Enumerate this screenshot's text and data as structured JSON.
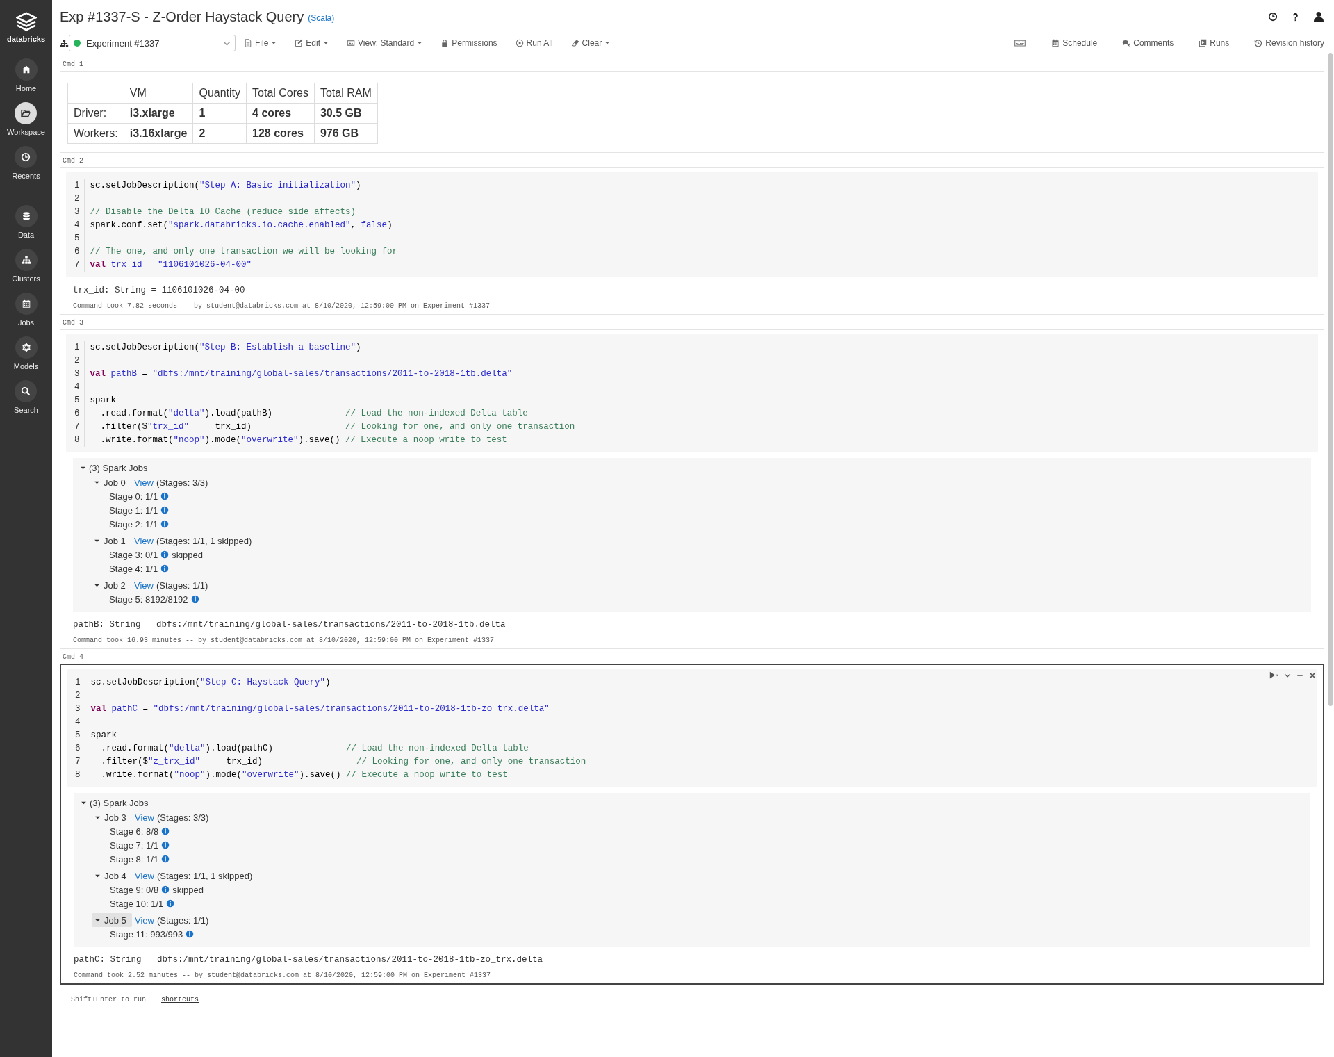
{
  "sidebar": {
    "logo": "databricks",
    "items": [
      {
        "label": "Home",
        "selected": false
      },
      {
        "label": "Workspace",
        "selected": true
      },
      {
        "label": "Recents",
        "selected": false
      },
      {
        "label": "Data",
        "selected": false
      },
      {
        "label": "Clusters",
        "selected": false
      },
      {
        "label": "Jobs",
        "selected": false
      },
      {
        "label": "Models",
        "selected": false
      },
      {
        "label": "Search",
        "selected": false
      }
    ]
  },
  "notebook": {
    "title": "Exp #1337-S - Z-Order Haystack Query",
    "language": "(Scala)",
    "cluster": "Experiment #1337",
    "toolbar_left": [
      {
        "label": "File",
        "menu": true
      },
      {
        "label": "Edit",
        "menu": true
      },
      {
        "label": "View: Standard",
        "menu": true
      },
      {
        "label": "Permissions",
        "menu": false
      },
      {
        "label": "Run All",
        "menu": false
      },
      {
        "label": "Clear",
        "menu": true
      }
    ],
    "toolbar_right": [
      {
        "kind": "icon"
      },
      {
        "kind": "button",
        "label": "Schedule"
      },
      {
        "kind": "button",
        "label": "Comments"
      },
      {
        "kind": "button",
        "label": "Runs"
      },
      {
        "kind": "button",
        "label": "Revision history"
      }
    ]
  },
  "cells": [
    {
      "label": "Cmd 1",
      "kind": "table",
      "active": false,
      "table": {
        "columns": [
          "VM",
          "Quantity",
          "Total Cores",
          "Total RAM"
        ],
        "rows": [
          {
            "label": "Driver:",
            "cells": [
              "i3.xlarge",
              "1",
              "4 cores",
              "30.5 GB"
            ]
          },
          {
            "label": "Workers:",
            "cells": [
              "i3.16xlarge",
              "2",
              "128 cores",
              "976 GB"
            ]
          }
        ]
      }
    },
    {
      "label": "Cmd 2",
      "kind": "code",
      "active": false,
      "code": [
        {
          "number": "1",
          "tokens": [
            {
              "kind": "plain",
              "text": "sc.setJobDescription("
            },
            {
              "kind": "string",
              "text": "\"Step A: Basic initialization\""
            },
            {
              "kind": "plain",
              "text": ")"
            }
          ]
        },
        {
          "number": "2"
        },
        {
          "number": "3",
          "tokens": [
            {
              "kind": "comment",
              "text": "// Disable the Delta IO Cache (reduce side affects)"
            }
          ]
        },
        {
          "number": "4",
          "tokens": [
            {
              "kind": "plain",
              "text": "spark.conf.set("
            },
            {
              "kind": "string",
              "text": "\"spark.databricks.io.cache.enabled\""
            },
            {
              "kind": "plain",
              "text": ", "
            },
            {
              "kind": "literal",
              "text": "false"
            },
            {
              "kind": "plain",
              "text": ")"
            }
          ]
        },
        {
          "number": "5"
        },
        {
          "number": "6",
          "tokens": [
            {
              "kind": "comment",
              "text": "// The one, and only one transaction we will be looking for"
            }
          ]
        },
        {
          "number": "7",
          "tokens": [
            {
              "kind": "keyword",
              "text": "val"
            },
            {
              "kind": "ident",
              "text": " trx_id"
            },
            {
              "kind": "plain",
              "text": " = "
            },
            {
              "kind": "string",
              "text": "\"1106101026-04-00\""
            }
          ]
        }
      ],
      "output": "trx_id: String = 1106101026-04-00",
      "timing": "Command took 7.82 seconds -- by student@databricks.com at 8/10/2020, 12:59:00 PM on Experiment #1337"
    },
    {
      "label": "Cmd 3",
      "kind": "code",
      "active": false,
      "code": [
        {
          "number": "1",
          "tokens": [
            {
              "kind": "plain",
              "text": "sc.setJobDescription("
            },
            {
              "kind": "string",
              "text": "\"Step B: Establish a baseline\""
            },
            {
              "kind": "plain",
              "text": ")"
            }
          ]
        },
        {
          "number": "2"
        },
        {
          "number": "3",
          "tokens": [
            {
              "kind": "keyword",
              "text": "val"
            },
            {
              "kind": "ident",
              "text": " pathB"
            },
            {
              "kind": "plain",
              "text": " = "
            },
            {
              "kind": "string",
              "text": "\"dbfs:/mnt/training/global-sales/transactions/2011-to-2018-1tb.delta\""
            }
          ]
        },
        {
          "number": "4"
        },
        {
          "number": "5",
          "tokens": [
            {
              "kind": "plain",
              "text": "spark"
            }
          ]
        },
        {
          "number": "6",
          "tokens": [
            {
              "kind": "plain",
              "text": "  .read.format("
            },
            {
              "kind": "string",
              "text": "\"delta\""
            },
            {
              "kind": "plain",
              "text": ").load(pathB)              "
            },
            {
              "kind": "comment",
              "text": "// Load the non-indexed Delta table"
            }
          ]
        },
        {
          "number": "7",
          "tokens": [
            {
              "kind": "plain",
              "text": "  .filter($"
            },
            {
              "kind": "string",
              "text": "\"trx_id\""
            },
            {
              "kind": "plain",
              "text": " === trx_id)                  "
            },
            {
              "kind": "comment",
              "text": "// Looking for one, and only one transaction"
            }
          ]
        },
        {
          "number": "8",
          "tokens": [
            {
              "kind": "plain",
              "text": "  .write.format("
            },
            {
              "kind": "string",
              "text": "\"noop\""
            },
            {
              "kind": "plain",
              "text": ").mode("
            },
            {
              "kind": "string",
              "text": "\"overwrite\""
            },
            {
              "kind": "plain",
              "text": ").save() "
            },
            {
              "kind": "comment",
              "text": "// Execute a noop write to test"
            }
          ]
        }
      ],
      "spark_jobs": {
        "label": "(3) Spark Jobs",
        "expanded": true,
        "jobs": [
          {
            "label": "Job 0",
            "link": "View",
            "detail": "(Stages: 3/3)",
            "expanded": true,
            "selected": false,
            "stages": [
              {
                "label": "Stage 0: 1/1"
              },
              {
                "label": "Stage 1: 1/1"
              },
              {
                "label": "Stage 2: 1/1"
              }
            ]
          },
          {
            "label": "Job 1",
            "link": "View",
            "detail": "(Stages: 1/1, 1 skipped)",
            "expanded": true,
            "selected": false,
            "stages": [
              {
                "label": "Stage 3: 0/1",
                "note": "skipped"
              },
              {
                "label": "Stage 4: 1/1"
              }
            ]
          },
          {
            "label": "Job 2",
            "link": "View",
            "detail": "(Stages: 1/1)",
            "expanded": true,
            "selected": false,
            "stages": [
              {
                "label": "Stage 5: 8192/8192"
              }
            ]
          }
        ]
      },
      "output": "pathB: String = dbfs:/mnt/training/global-sales/transactions/2011-to-2018-1tb.delta",
      "timing": "Command took 16.93 minutes -- by student@databricks.com at 8/10/2020, 12:59:00 PM on Experiment #1337"
    },
    {
      "label": "Cmd 4",
      "kind": "code",
      "active": true,
      "code": [
        {
          "number": "1",
          "tokens": [
            {
              "kind": "plain",
              "text": "sc.setJobDescription("
            },
            {
              "kind": "string",
              "text": "\"Step C: Haystack Query\""
            },
            {
              "kind": "plain",
              "text": ")"
            }
          ]
        },
        {
          "number": "2"
        },
        {
          "number": "3",
          "tokens": [
            {
              "kind": "keyword",
              "text": "val"
            },
            {
              "kind": "ident",
              "text": " pathC"
            },
            {
              "kind": "plain",
              "text": " = "
            },
            {
              "kind": "string",
              "text": "\"dbfs:/mnt/training/global-sales/transactions/2011-to-2018-1tb-zo_trx.delta\""
            }
          ]
        },
        {
          "number": "4"
        },
        {
          "number": "5",
          "tokens": [
            {
              "kind": "plain",
              "text": "spark"
            }
          ]
        },
        {
          "number": "6",
          "tokens": [
            {
              "kind": "plain",
              "text": "  .read.format("
            },
            {
              "kind": "string",
              "text": "\"delta\""
            },
            {
              "kind": "plain",
              "text": ").load(pathC)              "
            },
            {
              "kind": "comment",
              "text": "// Load the non-indexed Delta table"
            }
          ]
        },
        {
          "number": "7",
          "tokens": [
            {
              "kind": "plain",
              "text": "  .filter($"
            },
            {
              "kind": "string",
              "text": "\"z_trx_id\""
            },
            {
              "kind": "plain",
              "text": " === trx_id)                  "
            },
            {
              "kind": "comment",
              "text": "// Looking for one, and only one transaction"
            }
          ]
        },
        {
          "number": "8",
          "tokens": [
            {
              "kind": "plain",
              "text": "  .write.format("
            },
            {
              "kind": "string",
              "text": "\"noop\""
            },
            {
              "kind": "plain",
              "text": ").mode("
            },
            {
              "kind": "string",
              "text": "\"overwrite\""
            },
            {
              "kind": "plain",
              "text": ").save() "
            },
            {
              "kind": "comment",
              "text": "// Execute a noop write to test"
            }
          ]
        }
      ],
      "spark_jobs": {
        "label": "(3) Spark Jobs",
        "expanded": true,
        "jobs": [
          {
            "label": "Job 3",
            "link": "View",
            "detail": "(Stages: 3/3)",
            "expanded": true,
            "selected": false,
            "stages": [
              {
                "label": "Stage 6: 8/8"
              },
              {
                "label": "Stage 7: 1/1"
              },
              {
                "label": "Stage 8: 1/1"
              }
            ]
          },
          {
            "label": "Job 4",
            "link": "View",
            "detail": "(Stages: 1/1, 1 skipped)",
            "expanded": true,
            "selected": false,
            "stages": [
              {
                "label": "Stage 9: 0/8",
                "note": "skipped"
              },
              {
                "label": "Stage 10: 1/1"
              }
            ]
          },
          {
            "label": "Job 5",
            "link": "View",
            "detail": "(Stages: 1/1)",
            "expanded": true,
            "selected": true,
            "stages": [
              {
                "label": "Stage 11: 993/993"
              }
            ]
          }
        ]
      },
      "output": "pathC: String = dbfs:/mnt/training/global-sales/transactions/2011-to-2018-1tb-zo_trx.delta",
      "timing": "Command took 2.52 minutes -- by student@databricks.com at 8/10/2020, 12:59:00 PM on Experiment #1337"
    }
  ],
  "footer": {
    "hint": "Shift+Enter to run",
    "link": "shortcuts"
  }
}
